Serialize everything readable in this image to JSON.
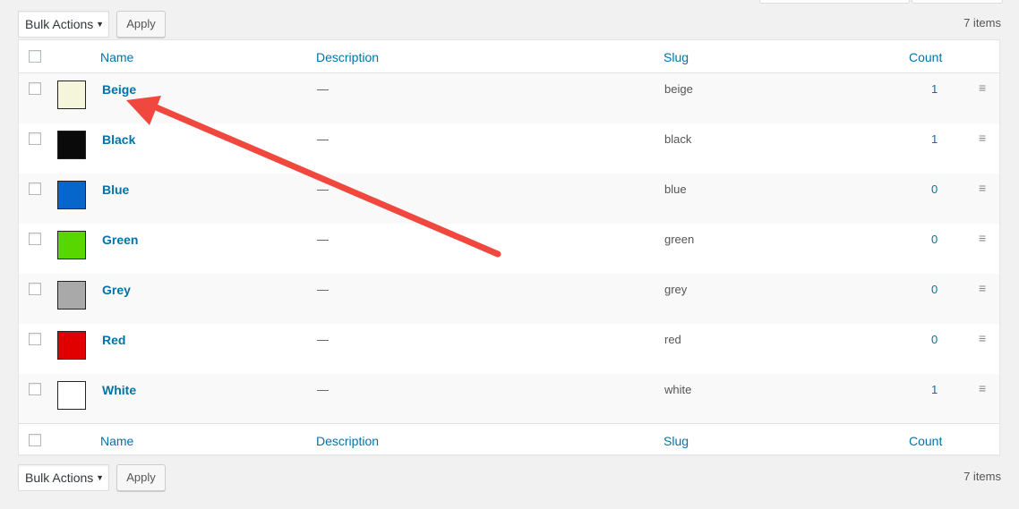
{
  "toolbar_top": {
    "bulk_actions": "Bulk Actions",
    "apply": "Apply",
    "item_count": "7 items"
  },
  "toolbar_bottom": {
    "bulk_actions": "Bulk Actions",
    "apply": "Apply",
    "item_count": "7 items"
  },
  "columns": {
    "name": "Name",
    "description": "Description",
    "slug": "Slug",
    "count": "Count"
  },
  "rows": [
    {
      "name": "Beige",
      "description": "—",
      "slug": "beige",
      "count": "1",
      "swatch": "#f5f5dc"
    },
    {
      "name": "Black",
      "description": "—",
      "slug": "black",
      "count": "1",
      "swatch": "#0a0a0a"
    },
    {
      "name": "Blue",
      "description": "—",
      "slug": "blue",
      "count": "0",
      "swatch": "#0766cc"
    },
    {
      "name": "Green",
      "description": "—",
      "slug": "green",
      "count": "0",
      "swatch": "#58d600"
    },
    {
      "name": "Grey",
      "description": "—",
      "slug": "grey",
      "count": "0",
      "swatch": "#a9a9a9"
    },
    {
      "name": "Red",
      "description": "—",
      "slug": "red",
      "count": "0",
      "swatch": "#e00000"
    },
    {
      "name": "White",
      "description": "—",
      "slug": "white",
      "count": "1",
      "swatch": "#ffffff"
    }
  ],
  "colors": {
    "link": "#0073aa",
    "annotation_arrow": "#f0483e"
  },
  "icons": {
    "drag_handle": "hamburger-icon",
    "select_arrow": "caret-down-icon",
    "annotation": "arrow-annotation-icon"
  }
}
